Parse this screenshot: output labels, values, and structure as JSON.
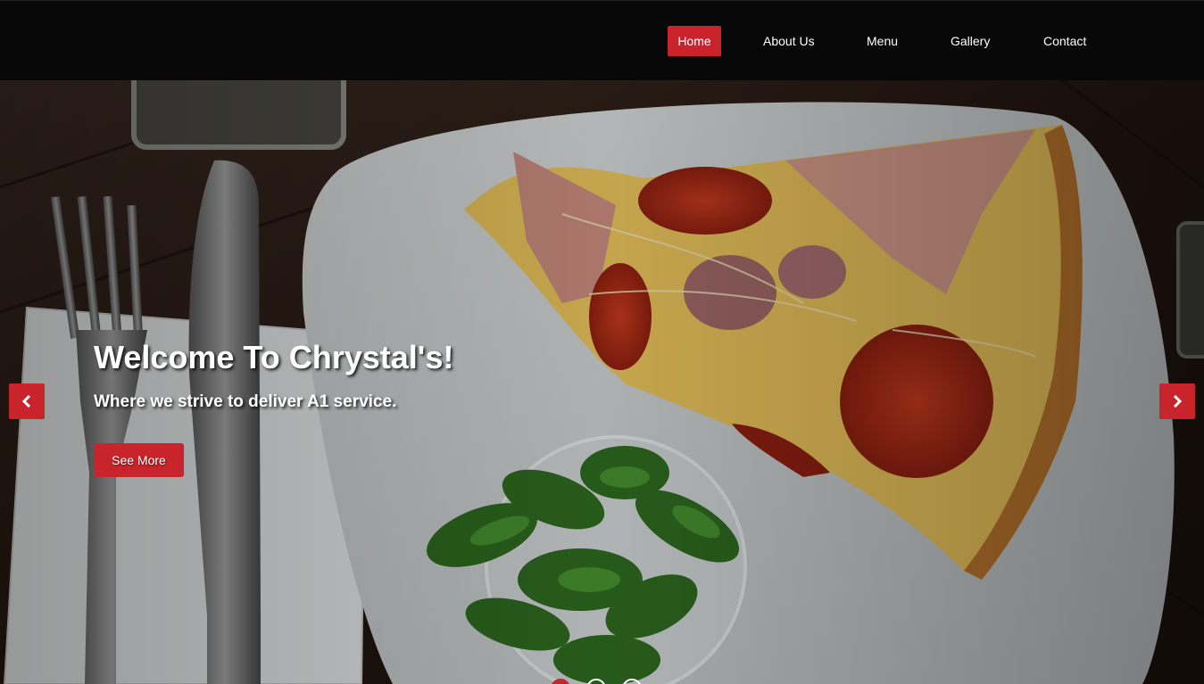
{
  "nav": {
    "items": [
      {
        "label": "Home",
        "active": true
      },
      {
        "label": "About Us",
        "active": false
      },
      {
        "label": "Menu",
        "active": false
      },
      {
        "label": "Gallery",
        "active": false
      },
      {
        "label": "Contact",
        "active": false
      }
    ]
  },
  "hero": {
    "title": "Welcome To Chrystal's!",
    "subtitle": "Where we strive to deliver A1 service.",
    "button_label": "See More",
    "prev_icon": "chevron-left-icon",
    "next_icon": "chevron-right-icon",
    "slide_count": 3,
    "active_slide": 1
  },
  "colors": {
    "accent": "#c9242b",
    "navbar_bg": "#080808",
    "text": "#ffffff"
  }
}
